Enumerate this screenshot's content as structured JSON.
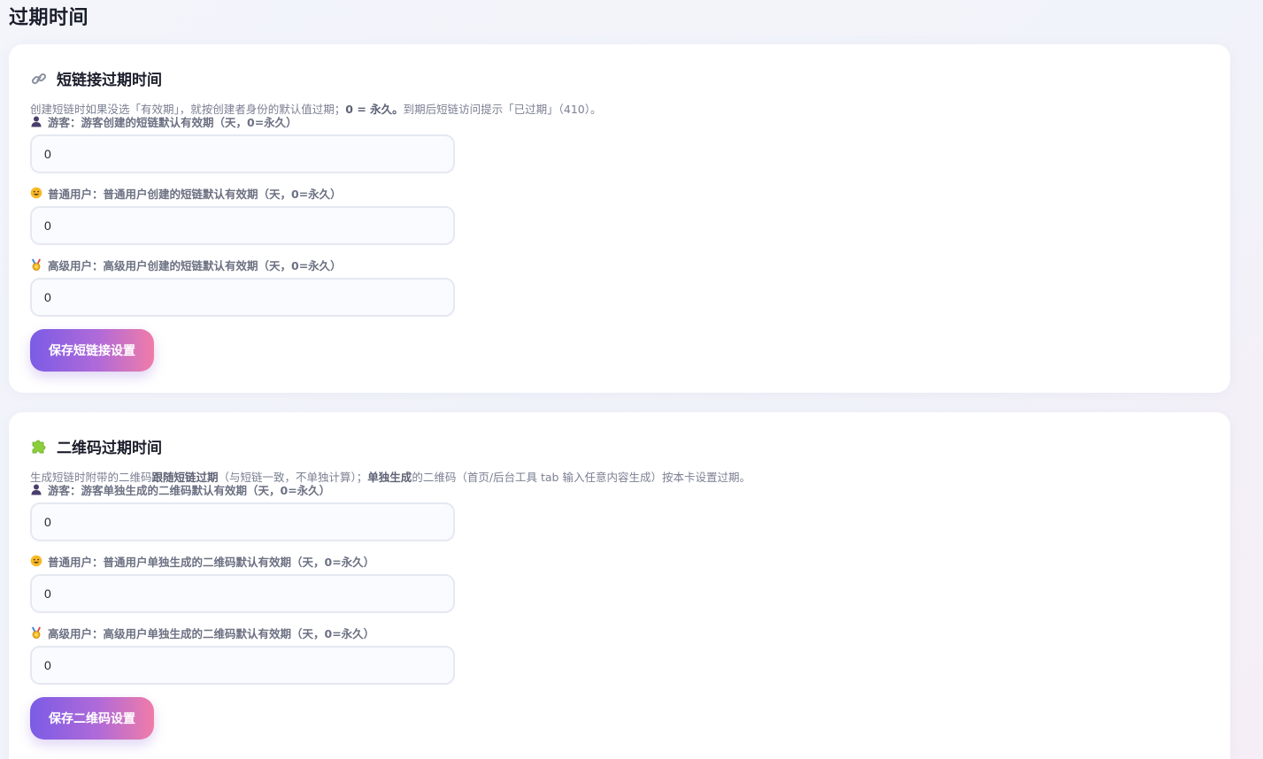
{
  "page": {
    "title": "过期时间"
  },
  "link_card": {
    "title": "短链接过期时间",
    "desc_prefix": "创建短链时如果没选「有效期」，就按创建者身份的默认值过期；",
    "desc_bold": "0 = 永久。",
    "desc_suffix": "到期后短链访问提示「已过期」（410）。",
    "fields": [
      {
        "role": "游客",
        "label": "游客：游客创建的短链默认有效期（天，0=永久）",
        "value": "0"
      },
      {
        "role": "普通用户",
        "label": "普通用户：普通用户创建的短链默认有效期（天，0=永久）",
        "value": "0"
      },
      {
        "role": "高级用户",
        "label": "高级用户：高级用户创建的短链默认有效期（天，0=永久）",
        "value": "0"
      }
    ],
    "save_label": "保存短链接设置"
  },
  "qr_card": {
    "title": "二维码过期时间",
    "desc_part1": "生成短链时附带的二维码",
    "desc_bold1": "跟随短链过期",
    "desc_part2": "（与短链一致，不单独计算）；",
    "desc_bold2": "单独生成",
    "desc_part3": "的二维码（首页/后台工具 tab 输入任意内容生成）按本卡设置过期。",
    "fields": [
      {
        "role": "游客",
        "label": "游客：游客单独生成的二维码默认有效期（天，0=永久）",
        "value": "0"
      },
      {
        "role": "普通用户",
        "label": "普通用户：普通用户单独生成的二维码默认有效期（天，0=永久）",
        "value": "0"
      },
      {
        "role": "高级用户",
        "label": "高级用户：高级用户单独生成的二维码默认有效期（天，0=永久）",
        "value": "0"
      }
    ],
    "save_label": "保存二维码设置"
  },
  "icons": {
    "link_card": "chain-link-icon",
    "qr_card": "puzzle-piece-icon",
    "guest": "person-silhouette-icon",
    "normal": "smiley-face-icon",
    "premium": "medal-icon"
  },
  "colors": {
    "button_gradient_start": "#7b5ce6",
    "button_gradient_end": "#f07ca8",
    "puzzle_green": "#8ccf3a"
  }
}
